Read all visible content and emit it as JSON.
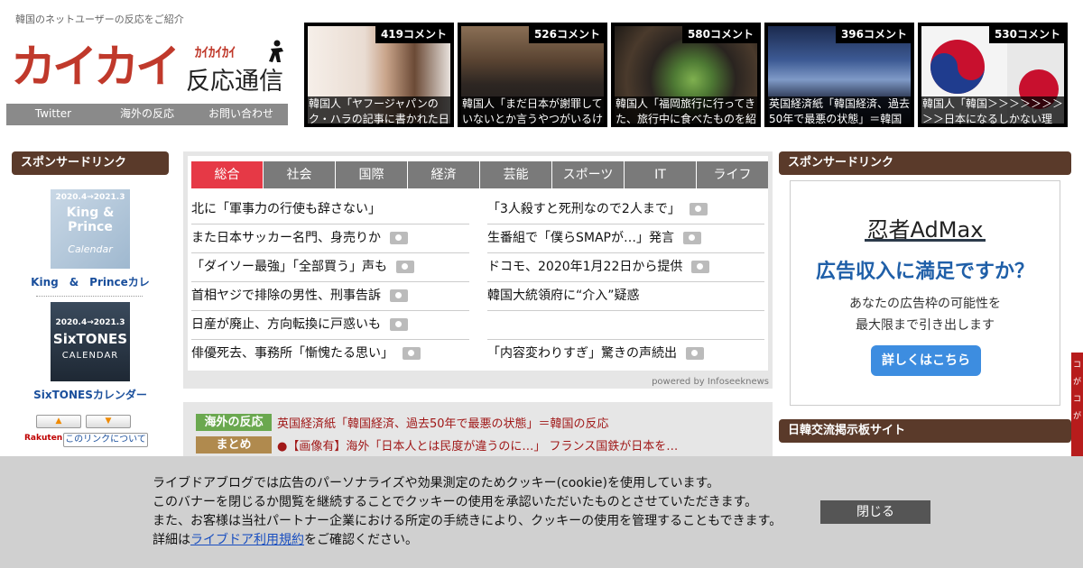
{
  "header": {
    "tagline": "韓国のネットユーザーの反応をご紹介",
    "logo_main": "カイカイ",
    "logo_sub_kana": "ｶｲｶｲｶｲ",
    "logo_sub_title": "反応通信",
    "nav": [
      "Twitter",
      "海外の反応",
      "お問い合わせ"
    ]
  },
  "thumbnails": [
    {
      "count": "419コメント",
      "caption": "韓国人「ヤフージャパンのク・ハラの記事に書かれた日"
    },
    {
      "count": "526コメント",
      "caption": "韓国人「まだ日本が謝罪していないとか言うやつがいるけ"
    },
    {
      "count": "580コメント",
      "caption": "韓国人「福岡旅行に行ってきた、旅行中に食べたものを紹"
    },
    {
      "count": "396コメント",
      "caption": "英国経済紙「韓国経済、過去50年で最悪の状態」＝韓国"
    },
    {
      "count": "530コメント",
      "caption": "韓国人「韓国＞＞＞＞＞＞＞＞＞日本になるしかない理"
    }
  ],
  "left_sidebar": {
    "heading": "スポンサードリンク",
    "products": [
      {
        "label": "King　&　Princeカレ",
        "art_line1": "2020.4→2021.3",
        "art_line2": "King & Prince",
        "art_line3": "Calendar"
      },
      {
        "label": "SixTONESカレンダー",
        "art_line1": "2020.4→2021.3",
        "art_line2": "SixTONES",
        "art_line3": "CALENDAR"
      }
    ],
    "up_arrow": "▲",
    "down_arrow": "▼",
    "rakuten": "Rakuten",
    "about_link": "このリンクについて"
  },
  "news": {
    "tabs": [
      "総合",
      "社会",
      "国際",
      "経済",
      "芸能",
      "スポーツ",
      "IT",
      "ライフ"
    ],
    "active_tab": 0,
    "left_items": [
      {
        "text": "北に「軍事力の行使も辞さない」",
        "camera": false
      },
      {
        "text": "また日本サッカー名門、身売りか",
        "camera": true
      },
      {
        "text": "「ダイソー最強」「全部買う」声も",
        "camera": true
      },
      {
        "text": "首相ヤジで排除の男性、刑事告訴",
        "camera": true
      },
      {
        "text": "日産が廃止、方向転換に戸惑いも",
        "camera": true
      },
      {
        "text": "俳優死去、事務所「慚愧たる思い」",
        "camera": true
      }
    ],
    "right_items": [
      {
        "text": "「3人殺すと死刑なので2人まで」",
        "camera": true
      },
      {
        "text": "生番組で「僕らSMAPが…」発言",
        "camera": true
      },
      {
        "text": "ドコモ、2020年1月22日から提供",
        "camera": true
      },
      {
        "text": "韓国大統領府に“介入”疑惑",
        "camera": false
      },
      {
        "text": "",
        "camera": false
      },
      {
        "text": "「内容変わりすぎ」驚きの声続出",
        "camera": true
      }
    ],
    "powered_by": "powered by Infoseeknews"
  },
  "related": [
    {
      "tag": "海外の反応",
      "tag_color": "#6aa84f",
      "text": "英国経済紙「韓国経済、過去50年で最悪の状態」＝韓国の反応"
    },
    {
      "tag": "まとめ",
      "tag_color": "#b08a4e",
      "text": "●【画像有】海外「日本人とは民度が違うのに…」 フランス国鉄が日本を…"
    }
  ],
  "right_sidebar": {
    "heading1": "スポンサードリンク",
    "ad": {
      "brand": "忍者AdMax",
      "headline": "広告収入に満足ですか？",
      "body1": "あなたの広告枠の可能性を",
      "body2": "最大限まで引き出します",
      "cta": "詳しくはこちら"
    },
    "heading2": "日韓交流掲示板サイト",
    "edge_tab": [
      "コ",
      "が",
      "コ",
      "が"
    ]
  },
  "cookie_banner": {
    "line1": "ライブドアブログでは広告のパーソナライズや効果測定のためクッキー(cookie)を使用しています。",
    "line2": "このバナーを閉じるか閲覧を継続することでクッキーの使用を承認いただいたものとさせていただきます。",
    "line3": "また、お客様は当社パートナー企業における所定の手続きにより、クッキーの使用を管理することもできます。",
    "line4_prefix": "詳細は",
    "line4_link": "ライブドア利用規約",
    "line4_suffix": "をご確認ください。",
    "close_label": "閉じる"
  },
  "colors": {
    "brand_red": "#c0392b",
    "tab_active": "#e63946",
    "sidebar_head": "#5a3a2a",
    "link_red": "#a01818"
  }
}
